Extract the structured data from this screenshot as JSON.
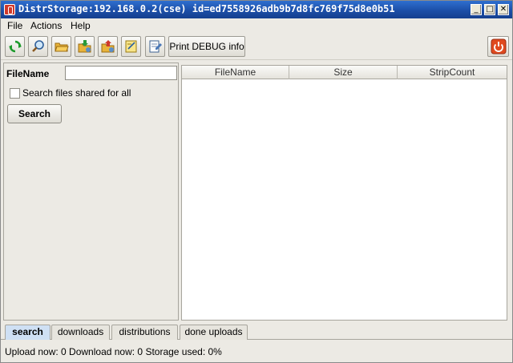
{
  "window": {
    "title": "DistrStorage:192.168.0.2(cse) id=ed7558926adb9b7d8fc769f75d8e0b51",
    "controls": {
      "minimize": "_",
      "maximize": "□",
      "close": "✕"
    }
  },
  "menu": {
    "file": "File",
    "actions": "Actions",
    "help": "Help"
  },
  "toolbar": {
    "icons": [
      "refresh-icon",
      "search-icon",
      "open-folder-icon",
      "download-folder-icon",
      "upload-folder-icon",
      "notes-icon",
      "document-edit-icon"
    ],
    "debug_label": "Print DEBUG info",
    "power_icon": "power-icon"
  },
  "search_panel": {
    "filename_label": "FileName",
    "filename_value": "",
    "shared_label": "Search files shared for all",
    "shared_checked": false,
    "search_button": "Search"
  },
  "table": {
    "columns": [
      "FileName",
      "Size",
      "StripCount"
    ],
    "rows": []
  },
  "tabs": [
    {
      "label": "search",
      "selected": true
    },
    {
      "label": "downloads",
      "selected": false
    },
    {
      "label": "distributions",
      "selected": false
    },
    {
      "label": "done uploads",
      "selected": false
    }
  ],
  "status": {
    "upload_label": "Upload now:",
    "upload_value": "0",
    "download_label": "Download now:",
    "download_value": "0",
    "storage_label": "Storage used:",
    "storage_value": "0%",
    "text": "Upload now: 0   Download now: 0   Storage used: 0%"
  },
  "colors": {
    "titlebar": "#1c4fa8",
    "selected_tab": "#cfe0f4",
    "power": "#e04a1f"
  }
}
